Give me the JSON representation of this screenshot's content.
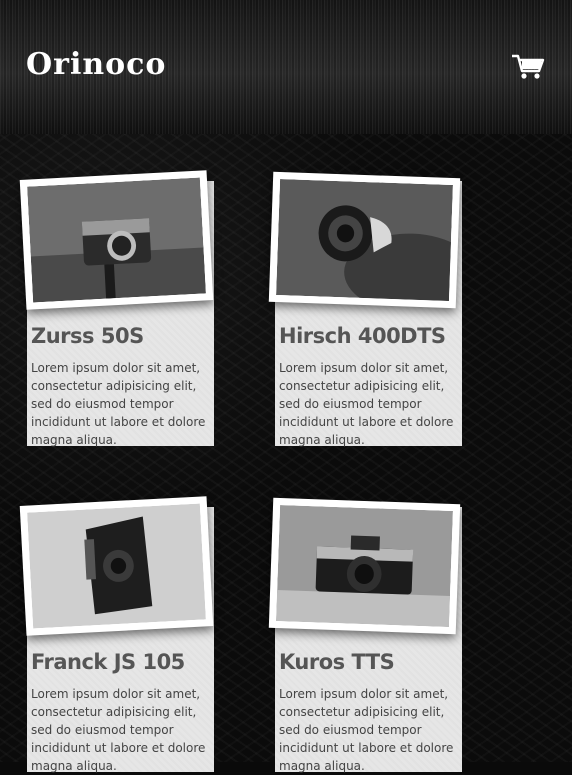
{
  "header": {
    "logo": "Orinoco"
  },
  "products": [
    {
      "name": "Zurss 50S",
      "description": "Lorem ipsum dolor sit amet, consectetur adipisicing elit, sed do eiusmod tempor incididunt ut labore et dolore magna aliqua."
    },
    {
      "name": "Hirsch 400DTS",
      "description": "Lorem ipsum dolor sit amet, consectetur adipisicing elit, sed do eiusmod tempor incididunt ut labore et dolore magna aliqua."
    },
    {
      "name": "Franck JS 105",
      "description": "Lorem ipsum dolor sit amet, consectetur adipisicing elit, sed do eiusmod tempor incididunt ut labore et dolore magna aliqua."
    },
    {
      "name": "Kuros TTS",
      "description": "Lorem ipsum dolor sit amet, consectetur adipisicing elit, sed do eiusmod tempor incididunt ut labore et dolore magna aliqua."
    }
  ],
  "icons": {
    "cart": "shopping-cart-icon"
  },
  "colors": {
    "header": "#1e1e1e",
    "card": "#e6e6e6",
    "title": "#555555",
    "text": "#444444"
  }
}
